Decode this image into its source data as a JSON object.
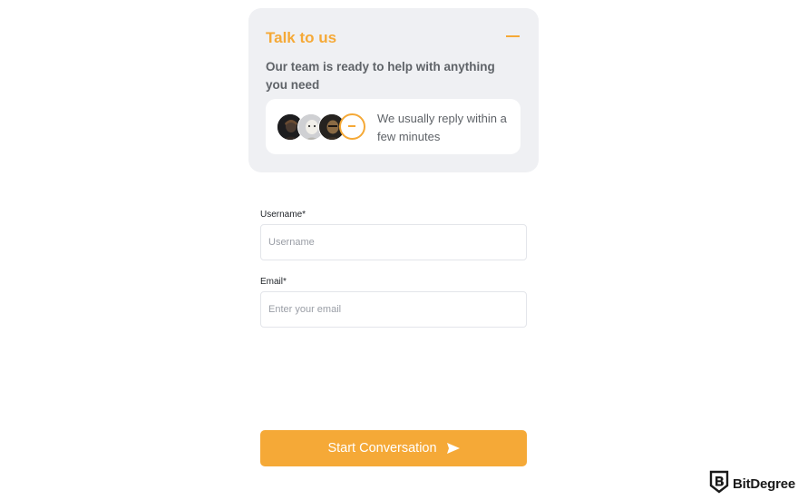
{
  "chat_widget": {
    "title": "Talk to us",
    "subtitle": "Our team is ready to help with anything you need",
    "reply_time": "We usually reply within a few minutes",
    "accent_color": "#f5a937",
    "card_background": "#eff0f3",
    "avatars": [
      "agent-avatar-1",
      "agent-avatar-2",
      "agent-avatar-3"
    ]
  },
  "form": {
    "username": {
      "label": "Username*",
      "placeholder": "Username",
      "value": ""
    },
    "email": {
      "label": "Email*",
      "placeholder": "Enter your email",
      "value": ""
    },
    "submit_label": "Start Conversation"
  },
  "watermark": {
    "text": "BitDegree"
  }
}
